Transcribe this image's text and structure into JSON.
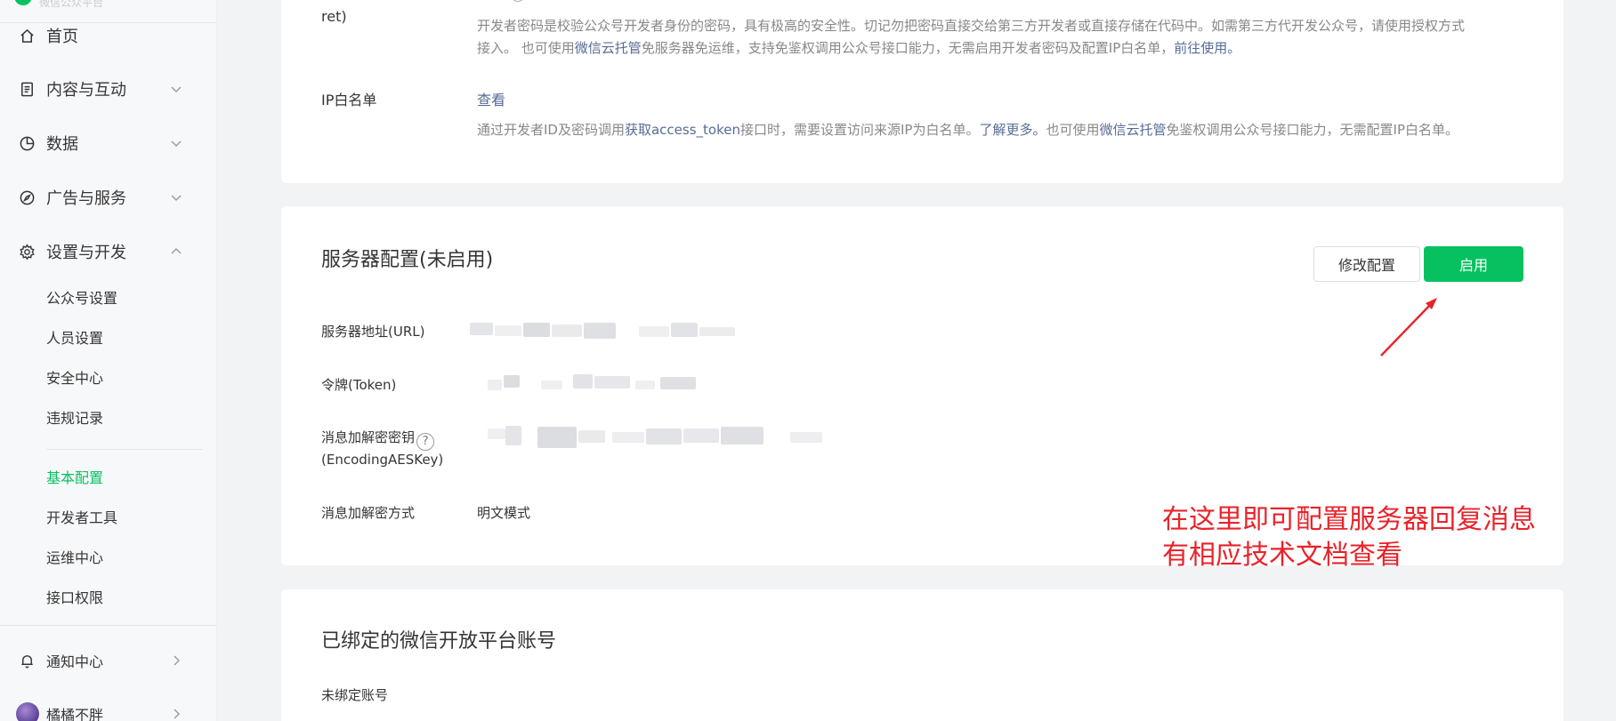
{
  "sidebar": {
    "logo_text": "微信公众平台",
    "nav": [
      {
        "label": "首页",
        "icon": "home-icon"
      },
      {
        "label": "内容与互动",
        "icon": "document-icon"
      },
      {
        "label": "数据",
        "icon": "pie-chart-icon"
      },
      {
        "label": "广告与服务",
        "icon": "compass-icon"
      },
      {
        "label": "设置与开发",
        "icon": "gear-icon"
      }
    ],
    "settings_sub": [
      "公众号设置",
      "人员设置",
      "安全中心",
      "违规记录"
    ],
    "dev_sub": [
      "基本配置",
      "开发者工具",
      "运维中心",
      "接口权限"
    ],
    "active_item": "基本配置",
    "notification": "通知中心",
    "account_name": "橘橘不胖"
  },
  "card_top": {
    "secret_label_tail": "ret)",
    "secret_desc_line1": "开发者密码是校验公众号开发者身份的密码，具有极高的安全性。切记勿把密码直接交给第三方开发者或直接存储在代码中。如需第三方代开发公众号，请使用授权方式",
    "secret_desc_line2_a": "接入。 也可使用",
    "secret_desc_link1": "微信云托管",
    "secret_desc_line2_b": "免服务器免运维，支持免鉴权调用公众号接口能力，无需启用开发者密码及配置IP白名单，",
    "secret_desc_link2": "前往使用。",
    "ip_label": "IP白名单",
    "ip_view": "查看",
    "ip_desc_a": "通过开发者ID及密码调用",
    "ip_desc_link1": "获取access_token",
    "ip_desc_b": "接口时，需要设置访问来源IP为白名单。",
    "ip_desc_link2": "了解更多。",
    "ip_desc_c": "也可使用",
    "ip_desc_link3": "微信云托管",
    "ip_desc_d": "免鉴权调用公众号接口能力，无需配置IP白名单。"
  },
  "server_config": {
    "title": "服务器配置(未启用)",
    "modify_button": "修改配置",
    "enable_button": "启用",
    "url_label": "服务器地址(URL)",
    "token_label": "令牌(Token)",
    "aes_label_line1": "消息加解密密钥",
    "aes_label_line2": "(EncodingAESKey)",
    "help_glyph": "?",
    "encrypt_label": "消息加解密方式",
    "encrypt_value": "明文模式"
  },
  "open_platform": {
    "title": "已绑定的微信开放平台账号",
    "status": "未绑定账号"
  },
  "annotation": {
    "line1": "在这里即可配置服务器回复消息",
    "line2": "有相应技术文档查看",
    "color": "#e8232b"
  },
  "colors": {
    "accent": "#07c160",
    "link": "#576b95"
  }
}
